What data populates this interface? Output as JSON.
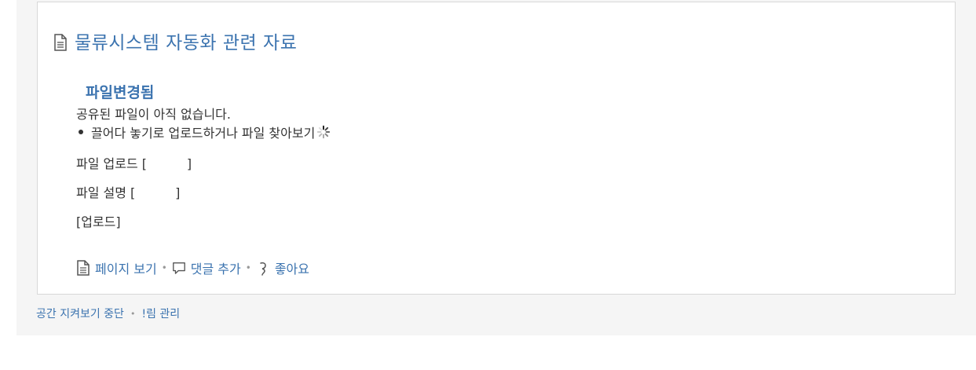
{
  "page": {
    "title": "물류시스템 자동화 관련 자료",
    "status": "파일변경됨",
    "no_files": "공유된 파일이 아직 없습니다.",
    "drop_hint": "끌어다 놓기로 업로드하거나 파일 찾아보기",
    "upload_field": "파일 업로드 [          ]",
    "desc_field": "파일 설명 [          ]",
    "upload_button": "[업로드]"
  },
  "actions": {
    "view_page": "페이지 보기",
    "add_comment": "댓글 추가",
    "like": "좋아요"
  },
  "footer": {
    "stop_watching": "공간 지켜보기 중단",
    "manage_notifications": "!림 관리"
  },
  "colors": {
    "link": "#3b73af",
    "text": "#333333",
    "panel": "#f5f5f5",
    "border": "#d8d8d8"
  },
  "icons": [
    "document-icon",
    "spinner-icon",
    "page-icon",
    "comment-icon",
    "like-icon"
  ]
}
